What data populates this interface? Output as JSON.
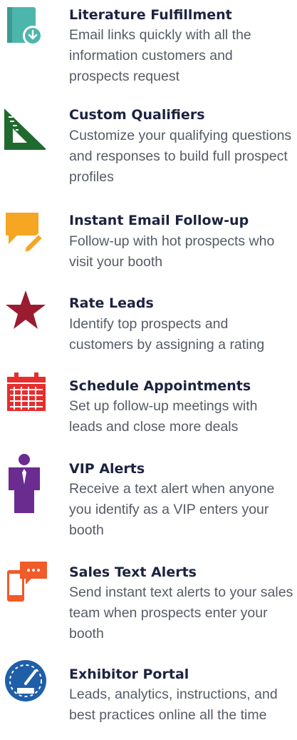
{
  "features": [
    {
      "title": "Literature Fulfillment",
      "description": "Email links quickly with all the information customers and prospects request",
      "icon": "book-download-icon",
      "color": "#4db6ac"
    },
    {
      "title": "Custom Qualifiers",
      "description": "Customize your qualifying questions and responses to build full prospect profiles",
      "icon": "triangle-ruler-icon",
      "color": "#1f6b2f"
    },
    {
      "title": "Instant Email Follow-up",
      "description": "Follow-up with hot prospects who visit your booth",
      "icon": "chat-pencil-icon",
      "color": "#f5a623"
    },
    {
      "title": "Rate Leads",
      "description": "Identify top prospects and customers by assigning a rating",
      "icon": "star-icon",
      "color": "#9b1b30"
    },
    {
      "title": "Schedule Appointments",
      "description": "Set up follow-up meetings with leads and close more deals",
      "icon": "calendar-icon",
      "color": "#e52f2f"
    },
    {
      "title": "VIP Alerts",
      "description": "Receive a text alert when anyone you identify as a VIP enters your booth",
      "icon": "person-icon",
      "color": "#6a2c8f"
    },
    {
      "title": "Sales Text Alerts",
      "description": "Send instant text alerts to your sales team when prospects enter your booth",
      "icon": "phone-message-icon",
      "color": "#f15a29"
    },
    {
      "title": "Exhibitor Portal",
      "description": "Leads, analytics, instructions, and best practices online all the time",
      "icon": "speedometer-icon",
      "color": "#1f5fa8"
    }
  ]
}
